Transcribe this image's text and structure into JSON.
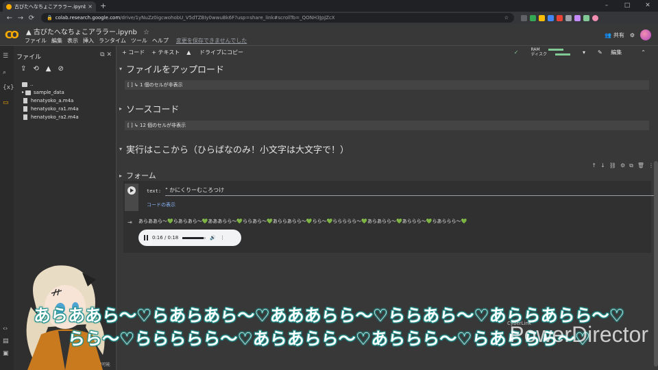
{
  "browser": {
    "tab_title": "古びたへなちょこアララー.ipynb",
    "tab_close": "×",
    "new_tab": "+",
    "window_controls": [
      "–",
      "□",
      "✕"
    ],
    "url_host": "colab.research.google.com",
    "url_path": "/drive/1yNuZz0igcwohobU_V5dTZBIy0wwuBk6F?usp=share_link#scrollTo=_QONH3JpJZcX"
  },
  "colab": {
    "notebook_title": "古びたへなちょこアララー.ipynb",
    "menu": [
      "ファイル",
      "編集",
      "表示",
      "挿入",
      "ランタイム",
      "ツール",
      "ヘルプ"
    ],
    "unsaved": "変更を保存できませんでした",
    "share_label": "共有"
  },
  "toolbar": {
    "add_code": "+ コード",
    "add_text": "+ テキスト",
    "copy_drive": "ドライブにコピー",
    "ram": "RAM",
    "disk": "ディスク",
    "edit": "編集"
  },
  "files": {
    "title": "ファイル",
    "tree": [
      "..",
      "sample_data",
      "henatyoko_a.m4a",
      "henatyoko_ra1.m4a",
      "henatyoko_ra2.m4a"
    ],
    "disk_note": "GB が利用可能"
  },
  "notebook": {
    "section1": "ファイルをアップロード",
    "hidden1": "[ ] ↳ 1 個のセルが非表示",
    "section2": "ソースコード",
    "hidden2": "[ ] ↳ 12 個のセルが非表示",
    "section3": "実行はここから（ひらばなのみ！小文字は大文字で！）",
    "form_title": "フォーム",
    "field_label": "text:",
    "field_value": "\" かにくりーむころつけ",
    "show_code": "コードの表示",
    "output": "あらああら〜💚らあらあら〜💚あああらら〜💚ららあら〜💚あららあらら〜💚らら〜💚ららららら〜💚あらあらら〜💚あららら〜💚らあららら〜💚",
    "audio_time": "0:16 / 0:18",
    "audio_progress": 0.89
  },
  "subtitle": {
    "line1": "あらああら〜♡らあらあら〜♡あああらら〜♡ららあら〜♡あららあらら〜♡",
    "line2": "らら〜♡ららららら〜♡あらあらら〜♡あららら〜♡らあららら〜♡"
  },
  "watermark": {
    "brand_small": "CyberLink",
    "brand": "PowerDirector"
  },
  "colors": {
    "accent": "#f9ab00",
    "subtitle_outline": "#1e8f8a",
    "link": "#8ab4f8"
  }
}
